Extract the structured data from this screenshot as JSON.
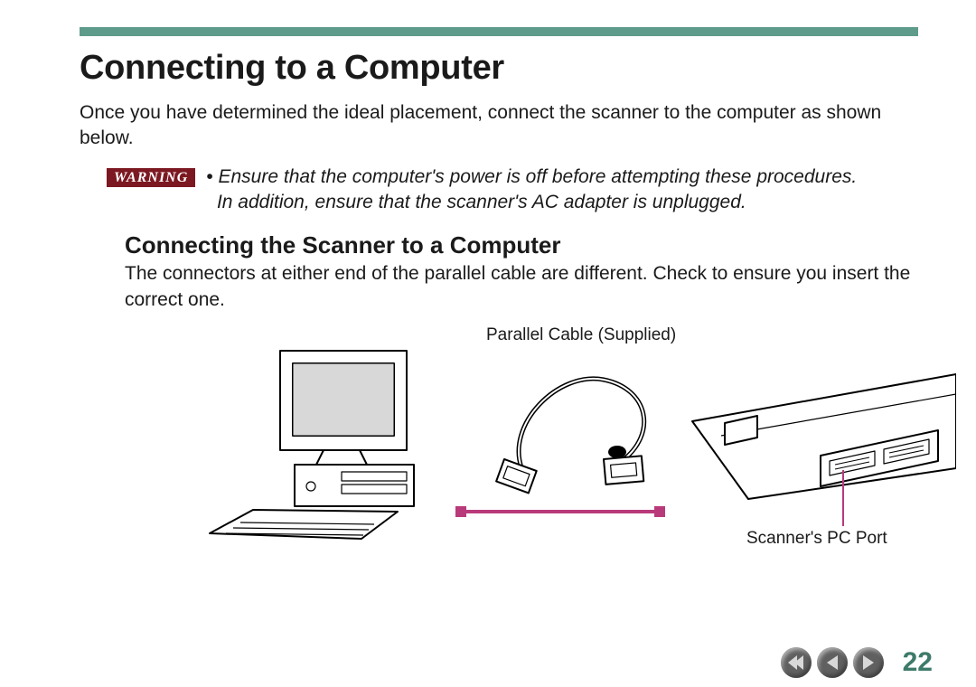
{
  "colors": {
    "rule": "#5f9b8a",
    "warning_bg": "#7c1821",
    "accent_magenta": "#b93a7a",
    "nav_bg": "#606060",
    "page_num": "#3d7a69"
  },
  "heading": "Connecting to a Computer",
  "intro": "Once you have determined the ideal placement, connect the scanner to the computer as shown below.",
  "warning": {
    "tag": "WARNING",
    "bullet": "•",
    "line1": "Ensure that the computer's power is off before attempting these procedures.",
    "line2": "In addition, ensure that the scanner's AC adapter is unplugged."
  },
  "subheading": "Connecting the Scanner to a Computer",
  "subbody": "The connectors at either end of the parallel cable are different. Check to ensure you insert the correct one.",
  "figure": {
    "cable_label": "Parallel Cable (Supplied)",
    "port_label": "Scanner's PC Port",
    "alt_computer": "Desktop computer with CRT monitor and keyboard (line art)",
    "alt_cable": "Parallel cable with two DB-25 style connectors (line art)",
    "alt_scanner": "Rear view of flatbed scanner showing PC port (line art)"
  },
  "nav": {
    "first": "first-page",
    "prev": "prev-page",
    "next": "next-page",
    "page_number": "22"
  }
}
